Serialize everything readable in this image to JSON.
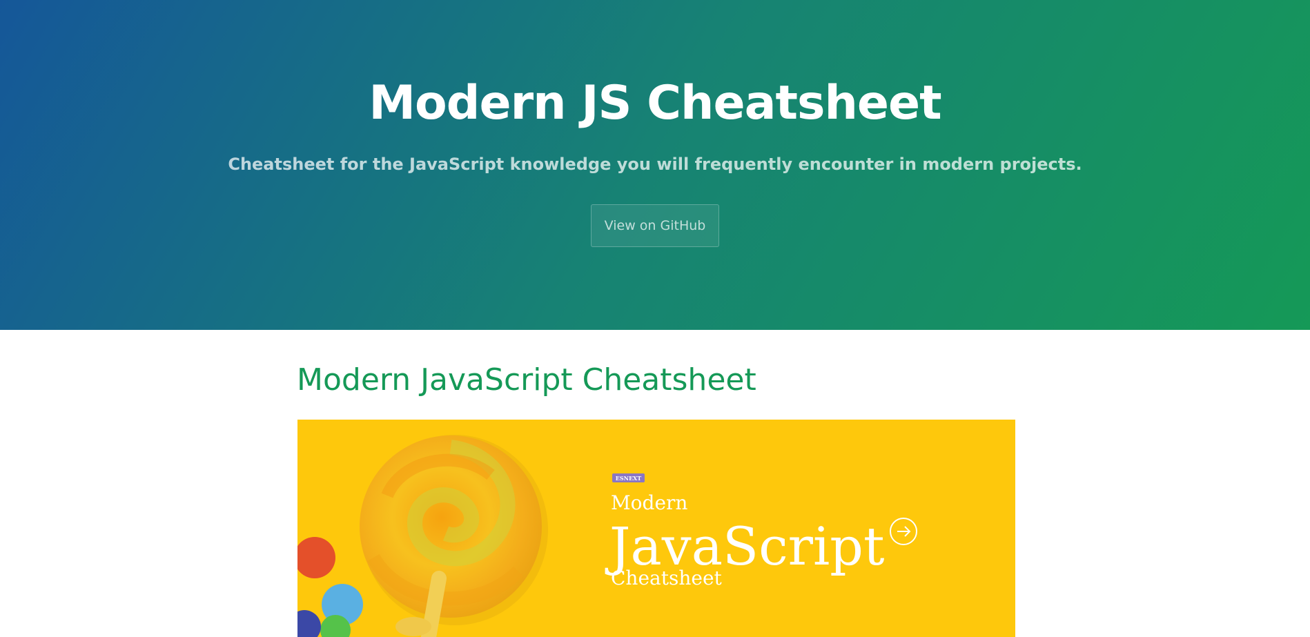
{
  "hero": {
    "title": "Modern JS Cheatsheet",
    "tagline": "Cheatsheet for the JavaScript knowledge you will frequently encounter in modern projects.",
    "github_button_label": "View on GitHub",
    "gradient_colors": [
      "#155799",
      "#159957"
    ]
  },
  "main": {
    "heading": "Modern JavaScript Cheatsheet",
    "heading_color": "#159957"
  },
  "banner": {
    "background_color": "#fec80c",
    "badge": "ESNEXT",
    "line1": "Modern",
    "line2": "JavaScript",
    "line3": "Cheatsheet",
    "icon": "arrow-right-circle-icon",
    "image": "lollipop-illustration"
  }
}
